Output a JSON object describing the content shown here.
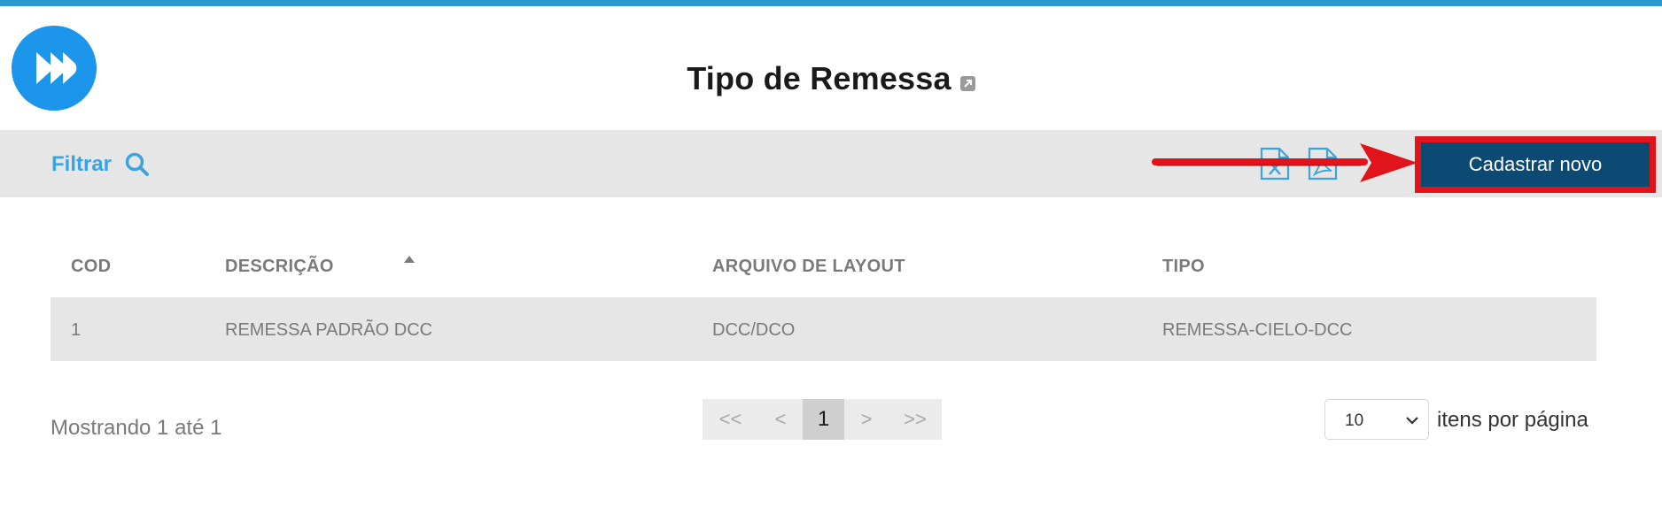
{
  "header": {
    "title": "Tipo de Remessa"
  },
  "toolbar": {
    "filter_label": "Filtrar",
    "new_button_label": "Cadastrar novo"
  },
  "table": {
    "columns": [
      "COD",
      "DESCRIÇÃO",
      "ARQUIVO DE LAYOUT",
      "TIPO"
    ],
    "sort": {
      "column": "DESCRIÇÃO",
      "direction": "asc"
    },
    "rows": [
      [
        "1",
        "REMESSA PADRÃO DCC",
        "DCC/DCO",
        "REMESSA-CIELO-DCC"
      ]
    ]
  },
  "footer": {
    "showing_text": "Mostrando 1 até 1",
    "pagination": [
      "<<",
      "<",
      "1",
      ">",
      ">>"
    ],
    "current_page": "1",
    "page_size": "10",
    "per_page_label": "itens por página"
  },
  "colors": {
    "accent": "#2f97d0",
    "logo": "#1c96ea",
    "button": "#0d4a73",
    "annotation_red": "#e2141b"
  },
  "icons": [
    "logo-icon",
    "external-link-icon",
    "search-icon",
    "excel-export-icon",
    "pdf-export-icon",
    "sort-asc-icon",
    "chevron-down-icon"
  ]
}
